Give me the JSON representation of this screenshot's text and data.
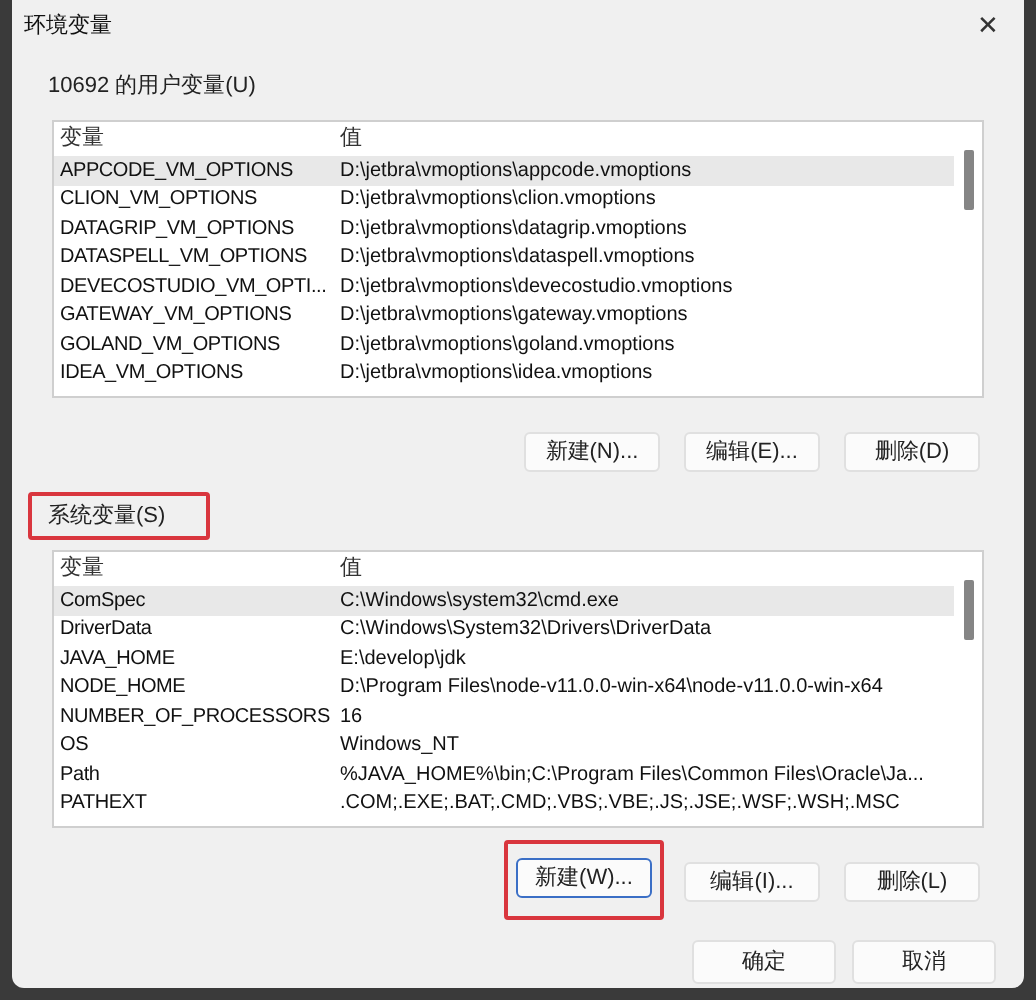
{
  "window": {
    "title": "环境变量",
    "close": "✕"
  },
  "sections": [
    {
      "label": "10692 的用户变量(U)",
      "highlighted": false,
      "columns": [
        "变量",
        "值"
      ],
      "rows": [
        {
          "name": "APPCODE_VM_OPTIONS",
          "value": "D:\\jetbra\\vmoptions\\appcode.vmoptions",
          "selected": true
        },
        {
          "name": "CLION_VM_OPTIONS",
          "value": "D:\\jetbra\\vmoptions\\clion.vmoptions",
          "selected": false
        },
        {
          "name": "DATAGRIP_VM_OPTIONS",
          "value": "D:\\jetbra\\vmoptions\\datagrip.vmoptions",
          "selected": false
        },
        {
          "name": "DATASPELL_VM_OPTIONS",
          "value": "D:\\jetbra\\vmoptions\\dataspell.vmoptions",
          "selected": false
        },
        {
          "name": "DEVECOSTUDIO_VM_OPTI...",
          "value": "D:\\jetbra\\vmoptions\\devecostudio.vmoptions",
          "selected": false
        },
        {
          "name": "GATEWAY_VM_OPTIONS",
          "value": "D:\\jetbra\\vmoptions\\gateway.vmoptions",
          "selected": false
        },
        {
          "name": "GOLAND_VM_OPTIONS",
          "value": "D:\\jetbra\\vmoptions\\goland.vmoptions",
          "selected": false
        },
        {
          "name": "IDEA_VM_OPTIONS",
          "value": "D:\\jetbra\\vmoptions\\idea.vmoptions",
          "selected": false
        }
      ],
      "buttons": [
        {
          "label": "新建(N)...",
          "highlighted": false
        },
        {
          "label": "编辑(E)...",
          "highlighted": false
        },
        {
          "label": "删除(D)",
          "highlighted": false
        }
      ]
    },
    {
      "label": "系统变量(S)",
      "highlighted": true,
      "columns": [
        "变量",
        "值"
      ],
      "rows": [
        {
          "name": "ComSpec",
          "value": "C:\\Windows\\system32\\cmd.exe",
          "selected": true
        },
        {
          "name": "DriverData",
          "value": "C:\\Windows\\System32\\Drivers\\DriverData",
          "selected": false
        },
        {
          "name": "JAVA_HOME",
          "value": "E:\\develop\\jdk",
          "selected": false
        },
        {
          "name": "NODE_HOME",
          "value": "D:\\Program Files\\node-v11.0.0-win-x64\\node-v11.0.0-win-x64",
          "selected": false
        },
        {
          "name": "NUMBER_OF_PROCESSORS",
          "value": "16",
          "selected": false
        },
        {
          "name": "OS",
          "value": "Windows_NT",
          "selected": false
        },
        {
          "name": "Path",
          "value": "%JAVA_HOME%\\bin;C:\\Program Files\\Common Files\\Oracle\\Ja...",
          "selected": false
        },
        {
          "name": "PATHEXT",
          "value": ".COM;.EXE;.BAT;.CMD;.VBS;.VBE;.JS;.JSE;.WSF;.WSH;.MSC",
          "selected": false
        }
      ],
      "buttons": [
        {
          "label": "新建(W)...",
          "highlighted": true
        },
        {
          "label": "编辑(I)...",
          "highlighted": false
        },
        {
          "label": "删除(L)",
          "highlighted": false
        }
      ]
    }
  ],
  "footer_buttons": [
    "确定",
    "取消"
  ]
}
